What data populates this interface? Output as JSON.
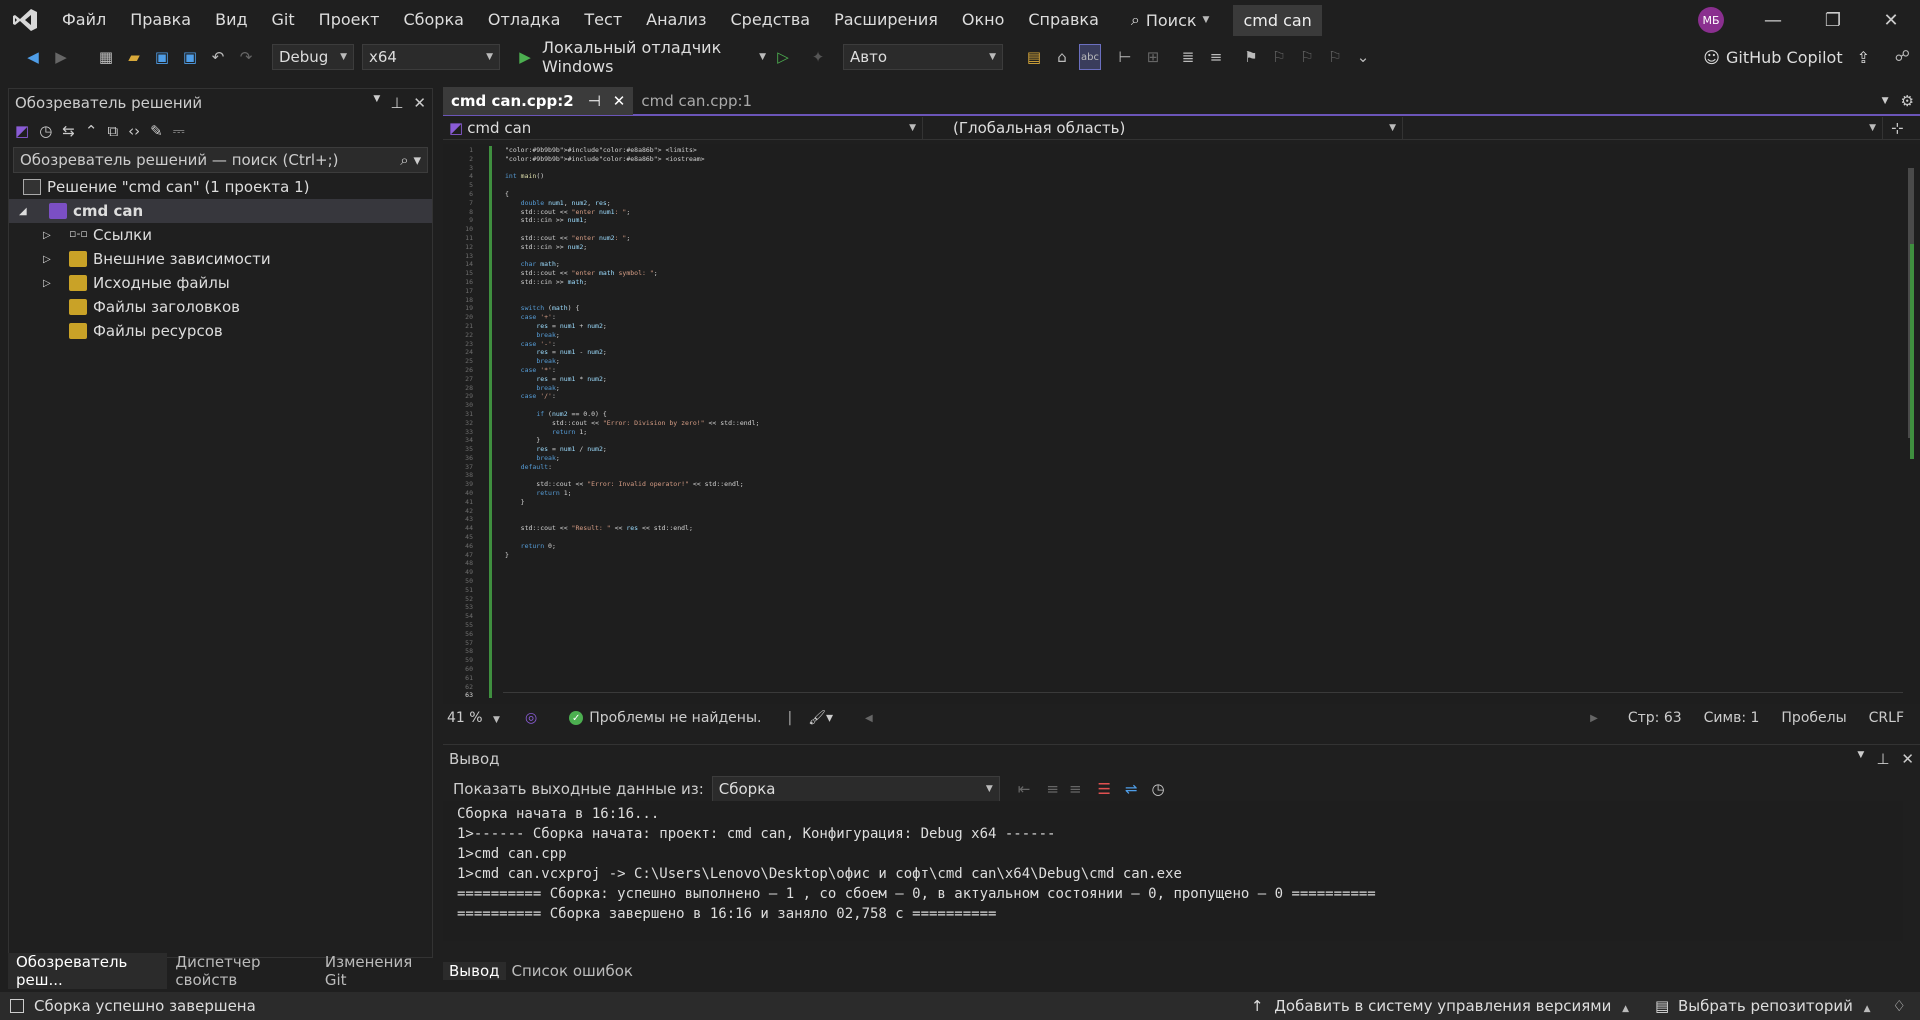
{
  "menu": [
    "Файл",
    "Правка",
    "Вид",
    "Git",
    "Проект",
    "Сборка",
    "Отладка",
    "Тест",
    "Анализ",
    "Средства",
    "Расширения",
    "Окно",
    "Справка"
  ],
  "search_label": "Поиск",
  "solution_title": "cmd can",
  "avatar": "МБ",
  "toolbar": {
    "config": "Debug",
    "platform": "x64",
    "debugger": "Локальный отладчик Windows",
    "auto": "Авто",
    "copilot": "GitHub Copilot"
  },
  "solution_explorer": {
    "title": "Обозреватель решений",
    "search_placeholder": "Обозреватель решений — поиск (Ctrl+;)",
    "solution": "Решение \"cmd can\"  (1 проекта 1)",
    "project": "cmd can",
    "items": [
      "Ссылки",
      "Внешние зависимости",
      "Исходные файлы",
      "Файлы заголовков",
      "Файлы ресурсов"
    ]
  },
  "left_tabs": [
    "Обозреватель реш...",
    "Диспетчер свойств",
    "Изменения Git"
  ],
  "editor": {
    "tabs": [
      "cmd can.cpp:2",
      "cmd can.cpp:1"
    ],
    "nav_project": "cmd can",
    "nav_scope": "(Глобальная область)",
    "zoom": "41 %",
    "issues": "Проблемы не найдены.",
    "line": "Стр: 63",
    "col": "Симв: 1",
    "spaces": "Пробелы",
    "eol": "CRLF"
  },
  "code_lines": [
    "#include <limits>",
    "#include <iostream>",
    "",
    "int main()",
    "",
    "{",
    "    double num1, num2, res;",
    "    std::cout << \"enter num1: \";",
    "    std::cin >> num1;",
    "",
    "    std::cout << \"enter num2: \";",
    "    std::cin >> num2;",
    "",
    "    char math;",
    "    std::cout << \"enter math symbol: \";",
    "    std::cin >> math;",
    "",
    "",
    "    switch (math) {",
    "    case '+':",
    "        res = num1 + num2;",
    "        break;",
    "    case '-':",
    "        res = num1 - num2;",
    "        break;",
    "    case '*':",
    "        res = num1 * num2;",
    "        break;",
    "    case '/':",
    "",
    "        if (num2 == 0.0) {",
    "            std::cout << \"Error: Division by zero!\" << std::endl;",
    "            return 1;",
    "        }",
    "        res = num1 / num2;",
    "        break;",
    "    default:",
    "",
    "        std::cout << \"Error: Invalid operator!\" << std::endl;",
    "        return 1;",
    "    }",
    "",
    "",
    "    std::cout << \"Result: \" << res << std::endl;",
    "",
    "    return 0;",
    "}"
  ],
  "line_count": 63,
  "output": {
    "title": "Вывод",
    "show_from_label": "Показать выходные данные из:",
    "source": "Сборка",
    "lines": [
      "Сборка начата в 16:16...",
      "1>------ Сборка начата: проект: cmd can, Конфигурация: Debug x64 ------",
      "1>cmd can.cpp",
      "1>cmd can.vcxproj -> C:\\Users\\Lenovo\\Desktop\\офис и софт\\cmd can\\x64\\Debug\\cmd can.exe",
      "========== Сборка: успешно выполнено — 1 , со сбоем — 0, в актуальном состоянии — 0, пропущено — 0 ==========",
      "========== Сборка завершено в 16:16 и заняло 02,758 с =========="
    ]
  },
  "output_tabs": [
    "Вывод",
    "Список ошибок"
  ],
  "status": {
    "message": "Сборка успешно завершена",
    "add_vcs": "Добавить в систему управления версиями",
    "repo": "Выбрать репозиторий"
  }
}
